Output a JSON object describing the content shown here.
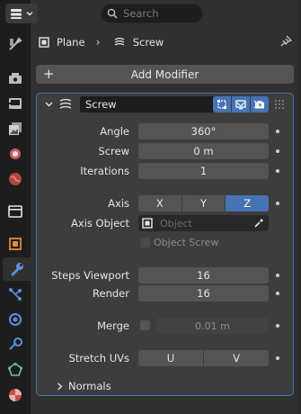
{
  "header": {
    "search_placeholder": "Search",
    "breadcrumb_object": "Plane",
    "breadcrumb_modifier": "Screw"
  },
  "add_modifier_label": "Add Modifier",
  "modifier": {
    "name": "Screw",
    "angle_label": "Angle",
    "angle_value": "360°",
    "screw_label": "Screw",
    "screw_value": "0 m",
    "iterations_label": "Iterations",
    "iterations_value": "1",
    "axis_label": "Axis",
    "axis_options": [
      "X",
      "Y",
      "Z"
    ],
    "axis_selected": "Z",
    "axis_object_label": "Axis Object",
    "axis_object_placeholder": "Object",
    "object_screw_label": "Object Screw",
    "steps_viewport_label": "Steps Viewport",
    "steps_viewport_value": "16",
    "render_label": "Render",
    "render_value": "16",
    "merge_label": "Merge",
    "merge_value": "0.01 m",
    "stretch_uvs_label": "Stretch UVs",
    "stretch_u": "U",
    "stretch_v": "V",
    "normals_label": "Normals"
  },
  "colors": {
    "accent": "#4772b3",
    "panel_bg": "#3d3d3d",
    "field_bg": "#545454",
    "editor_bg": "#303030",
    "tabs_bg": "#1d1d1d"
  }
}
